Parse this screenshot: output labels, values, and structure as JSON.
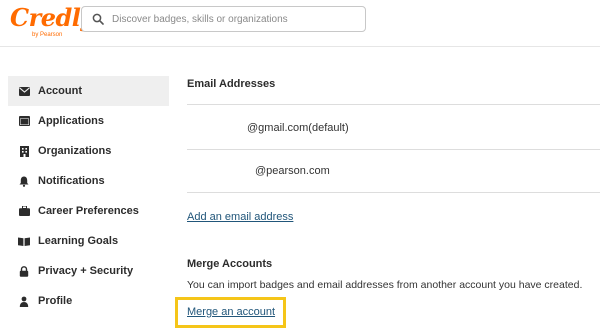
{
  "header": {
    "logo_text": "Credly",
    "logo_sub": "by Pearson",
    "search_placeholder": "Discover badges, skills or organizations"
  },
  "sidebar": {
    "items": [
      {
        "label": "Account",
        "icon": "envelope-icon",
        "active": true
      },
      {
        "label": "Applications",
        "icon": "window-icon",
        "active": false
      },
      {
        "label": "Organizations",
        "icon": "building-icon",
        "active": false
      },
      {
        "label": "Notifications",
        "icon": "bell-icon",
        "active": false
      },
      {
        "label": "Career Preferences",
        "icon": "briefcase-icon",
        "active": false
      },
      {
        "label": "Learning Goals",
        "icon": "book-icon",
        "active": false
      },
      {
        "label": "Privacy + Security",
        "icon": "lock-icon",
        "active": false
      },
      {
        "label": "Profile",
        "icon": "user-icon",
        "active": false
      }
    ]
  },
  "email_section": {
    "heading": "Email Addresses",
    "emails": [
      "@gmail.com(default)",
      "@pearson.com"
    ],
    "add_link": "Add an email address"
  },
  "merge_section": {
    "heading": "Merge Accounts",
    "description": "You can import badges and email addresses from another account you have created.",
    "merge_link": "Merge an account"
  },
  "colors": {
    "brand": "#ff6b00",
    "link": "#21567a",
    "highlight": "#f5c518",
    "active_bg": "#efefef"
  }
}
